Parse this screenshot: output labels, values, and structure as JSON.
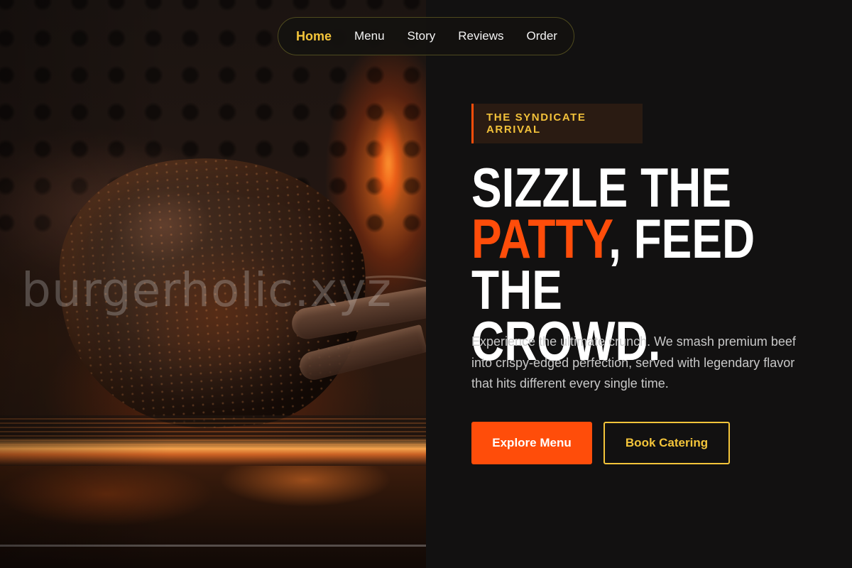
{
  "nav": {
    "items": [
      {
        "label": "Home",
        "active": true
      },
      {
        "label": "Menu",
        "active": false
      },
      {
        "label": "Story",
        "active": false
      },
      {
        "label": "Reviews",
        "active": false
      },
      {
        "label": "Order",
        "active": false
      }
    ]
  },
  "hero": {
    "watermark": "burgerholic.xyz",
    "eyebrow": "THE SYNDICATE ARRIVAL",
    "headline": {
      "line1": "SIZZLE THE",
      "highlight": "PATTY",
      "line2_rest": ", FEED THE",
      "line3": "CROWD."
    },
    "description": "Experience the ultimate crunch. We smash premium beef into crispy-edged perfection, served with legendary flavor that hits different every single time.",
    "primary_button": "Explore Menu",
    "secondary_button": "Book Catering"
  },
  "colors": {
    "accent_orange": "#ff4d0a",
    "accent_yellow": "#f3c43a",
    "background": "#121111"
  }
}
